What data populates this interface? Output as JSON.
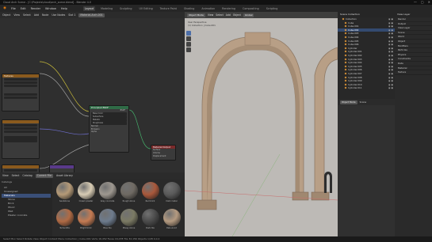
{
  "window": {
    "title": "Cloud Arch Scene - [C:\\Projects\\cloud\\arch_scene.blend] - Blender 4.0",
    "controls": [
      "—",
      "▢",
      "✕"
    ]
  },
  "menubar": {
    "items": [
      "File",
      "Edit",
      "Render",
      "Window",
      "Help"
    ],
    "tabs": [
      "Layout",
      "Modeling",
      "Sculpting",
      "UV Editing",
      "Texture Paint",
      "Shading",
      "Animation",
      "Rendering",
      "Compositing",
      "Scripting"
    ],
    "active_tab": "Layout"
  },
  "node_editor": {
    "header_items": [
      "Object",
      "View",
      "Select",
      "Add",
      "Node",
      "Use Nodes",
      "Slot 1",
      "Material.Arch.001"
    ],
    "nodes": [
      {
        "title": "Textures",
        "rows": [
          "",
          "",
          "",
          "",
          "",
          "",
          "",
          ""
        ]
      },
      {
        "title": "Principled BSDF",
        "rows": [
          "BSDF",
          "Base Color",
          "Subsurface",
          "Metallic",
          "Roughness",
          "Normal",
          "Emission",
          "Alpha"
        ]
      },
      {
        "title": "Material Output",
        "rows": [
          "Surface",
          "Volume",
          "Displacement"
        ]
      }
    ]
  },
  "file_browser": {
    "header_items": [
      "View",
      "Select",
      "Catalog",
      "Current File",
      "Asset Library"
    ],
    "sidebar_title": "Catalogs",
    "catalogs": [
      "All",
      "Unassigned",
      "Materials",
      "Stone",
      "Brick",
      "Wood",
      "Wall",
      "Plaster concrete"
    ],
    "selected_catalog": "Materials",
    "assets": [
      {
        "label": "Sandstone",
        "color": "#b59a77"
      },
      {
        "label": "Cream plaster",
        "color": "#d8ccb4"
      },
      {
        "label": "Grey concrete",
        "color": "#9e9890"
      },
      {
        "label": "Rough stone",
        "color": "#6f6a63"
      },
      {
        "label": "Red brick",
        "color": "#a9583b"
      },
      {
        "label": "Dark metal",
        "color": "#5a5a5a"
      },
      {
        "label": "Terracotta",
        "color": "#b06a44"
      },
      {
        "label": "Bright brick",
        "color": "#c47a52"
      },
      {
        "label": "Blue tile",
        "color": "#6d7b8d"
      },
      {
        "label": "Mossy stone",
        "color": "#7b7a64"
      },
      {
        "label": "Dark tile",
        "color": "#4b4b4b"
      },
      {
        "label": "Pale wood",
        "color": "#b49a80"
      }
    ]
  },
  "viewport": {
    "header_items": [
      "Object Mode",
      "View",
      "Select",
      "Add",
      "Object",
      "Global"
    ],
    "overlay_text": [
      "User Perspective",
      "(1) Collection | Cube.001"
    ],
    "arch_color": "#b89f86",
    "arch_shadow": "#8f7a66",
    "bg_color": "#b9b6b2"
  },
  "outliner": {
    "title": "Scene Collection",
    "items": [
      "Collection",
      "Cube",
      "Cube.001",
      "Cube.002",
      "Cube.003",
      "Cube.004",
      "Cube.005",
      "Cube.006",
      "Cylinder",
      "Cylinder.001",
      "Cylinder.002",
      "Cylinder.003",
      "Cylinder.004",
      "Cylinder.005",
      "Cylinder.006",
      "Cylinder.007",
      "Cylinder.008",
      "Cylinder.009",
      "Cylinder.010",
      "Cylinder.011"
    ],
    "selected_index": 3
  },
  "properties": {
    "header_items": [
      "Object Mode",
      "Scene"
    ]
  },
  "right_panel": {
    "title": "View Layer",
    "items": [
      "Render",
      "Output",
      "View Layer",
      "Scene",
      "World",
      "Object",
      "Modifiers",
      "Particles",
      "Physics",
      "Constraints",
      "Data",
      "Material",
      "Texture"
    ]
  },
  "statusbar": {
    "text": "Select   Box Select   Rotate View   Object Context Menu   Collection | Cube.001   Verts 16,452   Faces 16,078   Tris 32,156   Objects 1/28   4.0.2"
  },
  "colors": {
    "accent": "#3a4f78",
    "node_header_green": "#2f6b46",
    "node_header_red": "#7a2b2b",
    "node_header_orange": "#8a5a1e",
    "socket_yellow": "#c7b939",
    "socket_grey": "#a0a0a0",
    "socket_purple": "#6f6fd0"
  }
}
